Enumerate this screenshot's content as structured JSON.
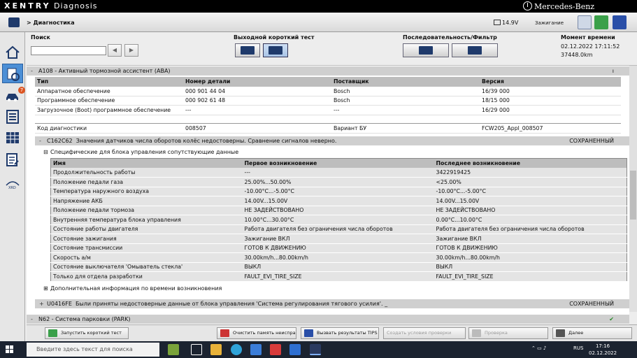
{
  "app": {
    "name": "XENTRY",
    "subtitle": "Diagnosis",
    "brand": "Mercedes-Benz"
  },
  "topbar": {
    "breadcrumb": "> Диагностика",
    "voltage": "14.9V",
    "ignition": "Зажигание"
  },
  "toolbar": {
    "search_label": "Поиск",
    "search_value": "",
    "test_label": "Выходной короткий тест",
    "sequence_label": "Последовательность/Фильтр",
    "moment_label": "Момент времени",
    "moment_date": "02.12.2022 17:11:52",
    "moment_value": "37448.0km"
  },
  "section_a108": {
    "title": "A108 - Активный тормозной ассистент (ABA)",
    "headers": [
      "Тип",
      "Номер детали",
      "Поставщик",
      "Версия"
    ],
    "rows": [
      [
        "Аппаратное обеспечение",
        "000 901 44 04",
        "Bosch",
        "16/39 000"
      ],
      [
        "Программное обеспечение",
        "000 902 61 48",
        "Bosch",
        "18/15 000"
      ],
      [
        "Загрузочное (Boot) программное обеспечение",
        "---",
        "---",
        "16/29 000"
      ]
    ],
    "diag_row": [
      "Код диагностики",
      "008507",
      "Вариант БУ",
      "FCW205_Appl_008507"
    ]
  },
  "fault1": {
    "code": "C162C62",
    "text": "Значения датчиков числа оборотов колёс недостоверны. Сравнение сигналов неверно.",
    "status": "СОХРАНЕННЫЙ"
  },
  "specific": {
    "title": "Специфические для блока управления сопутствующие данные",
    "headers": [
      "Имя",
      "Первое возникновение",
      "Последнее возникновение"
    ],
    "rows": [
      [
        "Продолжительность работы",
        "---",
        "3422919425"
      ],
      [
        "Положение педали газа",
        "25.00%...50.00%",
        "<25.00%"
      ],
      [
        "Температура наружного воздуха",
        "-10.00°C...-5.00°C",
        "-10.00°C...-5.00°C"
      ],
      [
        "Напряжение АКБ",
        "14.00V...15.00V",
        "14.00V...15.00V"
      ],
      [
        "Положение педали тормоза",
        "НЕ ЗАДЕЙСТВОВАНО",
        "НЕ ЗАДЕЙСТВОВАНО"
      ],
      [
        "Внутренняя температура блока управления",
        "10.00°C...30.00°C",
        "0.00°C...10.00°C"
      ],
      [
        "Состояние работы двигателя",
        "Работа двигателя без ограничения числа оборотов",
        "Работа двигателя без ограничения числа оборотов"
      ],
      [
        "Состояние зажигания",
        "Зажигание ВКЛ",
        "Зажигание ВКЛ"
      ],
      [
        "Состояние трансмиссии",
        "ГОТОВ К ДВИЖЕНИЮ",
        "ГОТОВ К ДВИЖЕНИЮ"
      ],
      [
        "Скорость а/м",
        "30.00km/h...80.00km/h",
        "30.00km/h...80.00km/h"
      ],
      [
        "Состояние выключателя 'Омыватель стекла'",
        "ВЫКЛ",
        "ВЫКЛ"
      ],
      [
        "Только для отдела разработки",
        "FAULT_EVI_TIRE_SIZE",
        "FAULT_EVI_TIRE_SIZE"
      ]
    ]
  },
  "additional": {
    "title": "Дополнительная информация по времени возникновения"
  },
  "fault2": {
    "code": "U0416FE",
    "text": "Были приняты недостоверные данные от блока управления 'Система регулирования тягового усилия'. _",
    "status": "СОХРАНЕННЫЙ"
  },
  "section_n62": {
    "title": "N62 - Система парковки (PARK)"
  },
  "bottom": {
    "quick_test": "Запустить короткий тест",
    "clear_memory": "Очистить память неисправностей",
    "tips": "Вызвать результаты TIPS",
    "create_check": "Создать условия проверки",
    "check": "Проверка",
    "next": "Далее"
  },
  "taskbar": {
    "search_placeholder": "Введите здесь текст для поиска",
    "lang": "RUS",
    "time": "17:16",
    "date": "02.12.2022"
  },
  "colors": {
    "accent": "#4c8fd6",
    "header_bg": "#cfcfcf",
    "row_bg": "#e4e4e4"
  }
}
